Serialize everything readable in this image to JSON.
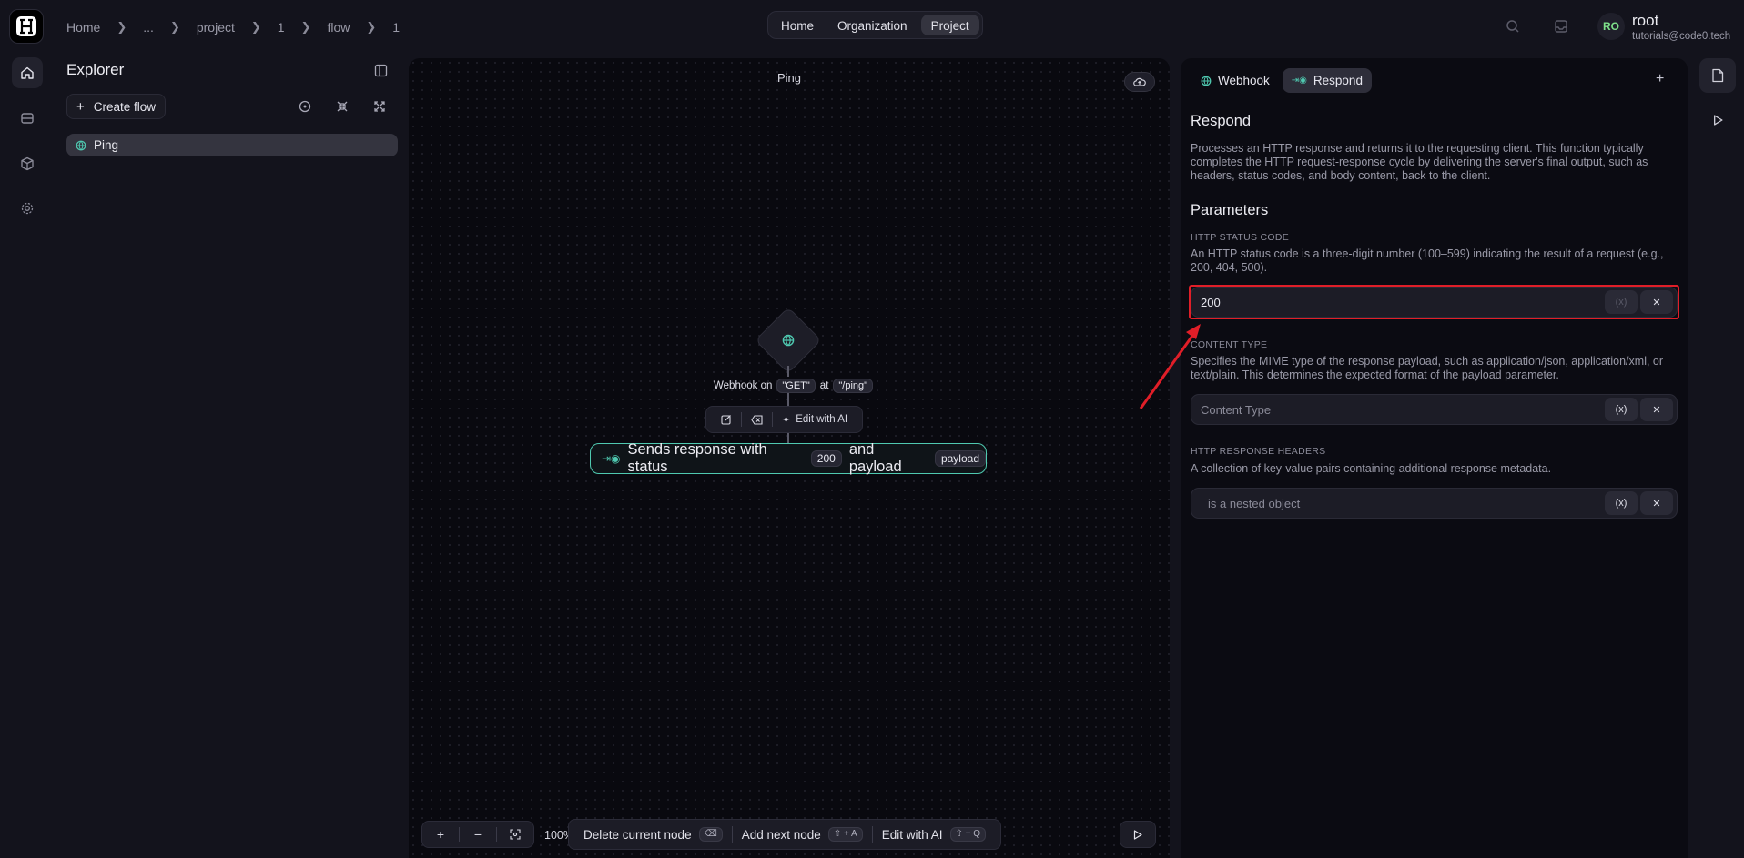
{
  "breadcrumbs": [
    "Home",
    "...",
    "project",
    "1",
    "flow",
    "1"
  ],
  "top_nav": {
    "home": "Home",
    "organization": "Organization",
    "project": "Project",
    "active": "Project"
  },
  "user": {
    "initials": "RO",
    "name": "root",
    "email": "tutorials@code0.tech"
  },
  "explorer": {
    "title": "Explorer",
    "create_flow": "Create flow",
    "items": [
      {
        "label": "Ping"
      }
    ]
  },
  "canvas": {
    "title": "Ping",
    "trigger": {
      "prefix": "Webhook on",
      "method": "\"GET\"",
      "at": "at",
      "path": "\"/ping\""
    },
    "toolbar": {
      "edit_ai": "Edit with AI"
    },
    "respond_node": {
      "text1": "Sends response with status",
      "status": "200",
      "text2": "and payload",
      "payload": "payload"
    },
    "zoom": "100%",
    "hints": {
      "delete": "Delete current node",
      "delete_key": "⌫",
      "add": "Add next node",
      "add_key": "⇧ + A",
      "edit": "Edit with AI",
      "edit_key": "⇧ + Q"
    }
  },
  "panel": {
    "tabs": [
      "Webhook",
      "Respond"
    ],
    "active_tab": "Respond",
    "title": "Respond",
    "description": "Processes an HTTP response and returns it to the requesting client. This function typically completes the HTTP request-response cycle by delivering the server's final output, such as headers, status codes, and body content, back to the client.",
    "parameters_title": "Parameters",
    "fields": {
      "status": {
        "label": "HTTP STATUS CODE",
        "description": "An HTTP status code is a three-digit number (100–599) indicating the result of a request (e.g., 200, 404, 500).",
        "value": "200"
      },
      "content_type": {
        "label": "CONTENT TYPE",
        "description": "Specifies the MIME type of the response payload, such as application/json, application/xml, or text/plain. This determines the expected format of the payload parameter.",
        "placeholder": "Content Type"
      },
      "headers": {
        "label": "HTTP RESPONSE HEADERS",
        "description": "A collection of key-value pairs containing additional response metadata.",
        "value": "is a nested object"
      }
    },
    "variable_button": "(x)"
  },
  "colors": {
    "accent": "#4fc9b0",
    "annotation": "#e01e28"
  }
}
